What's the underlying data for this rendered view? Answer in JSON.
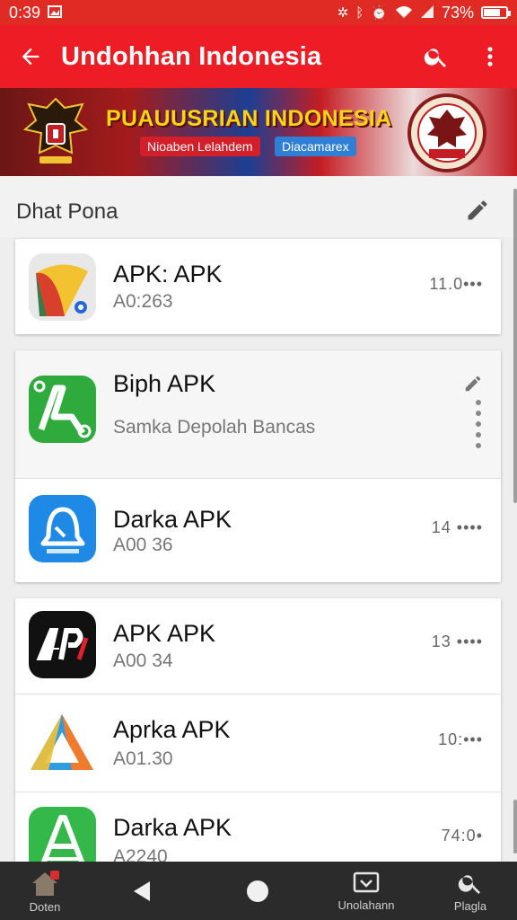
{
  "status_bar": {
    "time": "0:39",
    "battery": "73%",
    "battery_level": 0.73
  },
  "app_bar": {
    "title": "Undohhan Indonesia",
    "back_icon": "arrow-left-icon",
    "search_icon": "search-icon",
    "menu_icon": "more-vert-icon"
  },
  "banner": {
    "title": "PUAUUSRIAN INDONESIA",
    "tag_red": "Nioaben Lelahdem",
    "tag_blue": "Diacamarex"
  },
  "section": {
    "title": "Dhat Pona"
  },
  "apps": [
    {
      "name": "APK: APK",
      "sub": "A0:263",
      "meta": "11.0•••"
    },
    {
      "name": "Biph APK",
      "sub": "Samka Depolah Bancas",
      "meta": ""
    },
    {
      "name": "Darka APK",
      "sub": "A00 36",
      "meta": "14 ••••"
    },
    {
      "name": "APK APK",
      "sub": "A00 34",
      "meta": "13 ••••"
    },
    {
      "name": "Aprka APK",
      "sub": "A01.30",
      "meta": "10:•••"
    },
    {
      "name": "Darka APK",
      "sub": "A2240",
      "meta": "74:0•"
    }
  ],
  "nav": {
    "home_label": "Doten",
    "download_label": "Unolahann",
    "search_label": "Plagla"
  },
  "colors": {
    "primary": "#ee1c24",
    "status": "#e02a24",
    "nav": "#2b2b2b"
  }
}
